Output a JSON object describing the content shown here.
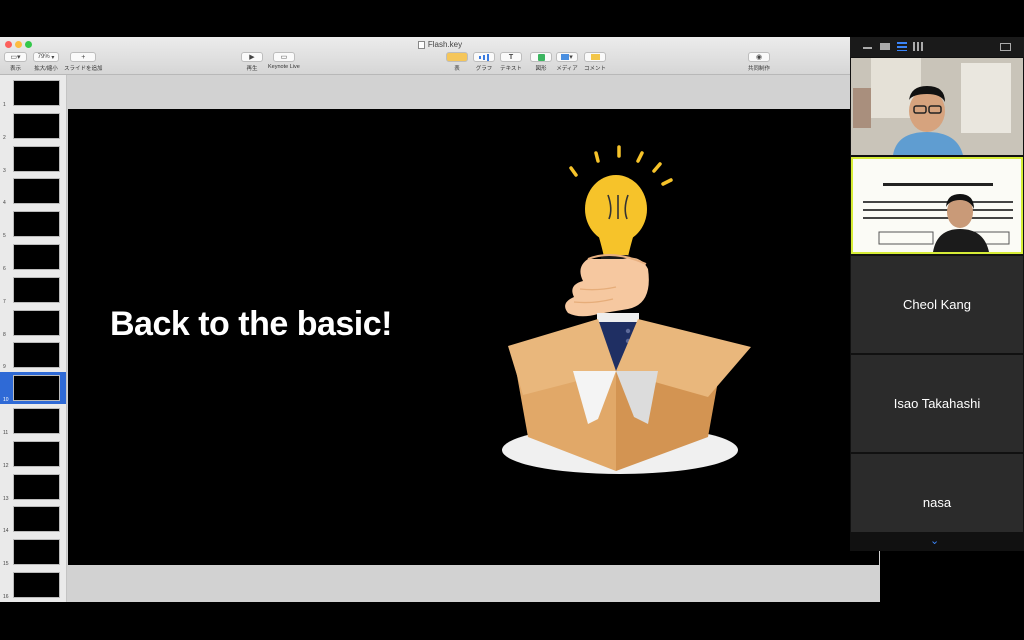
{
  "window": {
    "title": "Flash.key"
  },
  "toolbar": {
    "view": "表示",
    "zoom_value": "79%",
    "zoom_label": "拡大/縮小",
    "add_slide": "スライドを追加",
    "play": "再生",
    "keynote_live": "Keynote Live",
    "table": "表",
    "chart": "グラフ",
    "text": "テキスト",
    "shape": "図形",
    "media": "メディア",
    "comment": "コメント",
    "collaborate": "共同制作"
  },
  "slides": {
    "numbers": [
      "1",
      "2",
      "3",
      "4",
      "5",
      "6",
      "7",
      "8",
      "9",
      "10",
      "11",
      "12",
      "13",
      "14",
      "15",
      "16"
    ],
    "selected": "10"
  },
  "slide": {
    "headline": "Back to the basic!"
  },
  "zoom": {
    "participants": [
      "Cheol Kang",
      "Isao Takahashi",
      "nasa"
    ]
  },
  "colors": {
    "selection": "#2f6ad6",
    "bulb": "#f6c32a",
    "box": "#e1a868",
    "sleeve": "#1f2f63"
  }
}
